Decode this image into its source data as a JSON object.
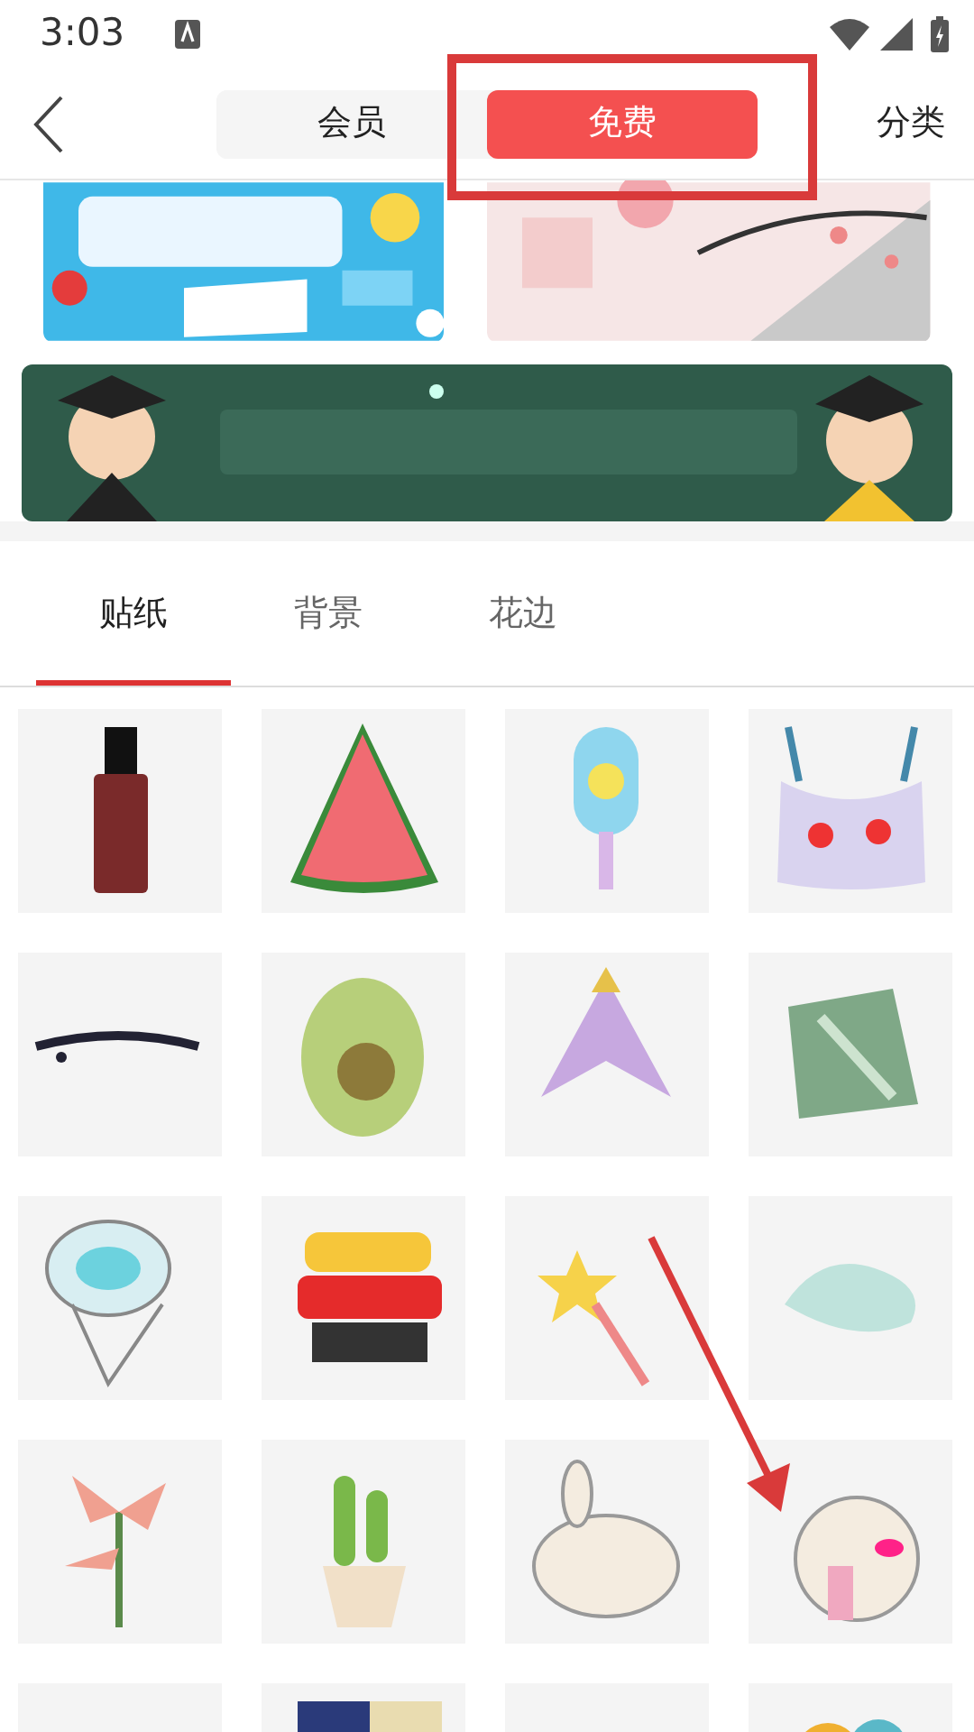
{
  "status_bar": {
    "time": "3:03"
  },
  "header": {
    "segments": [
      {
        "label": "会员",
        "selected": false
      },
      {
        "label": "免费",
        "selected": true
      }
    ],
    "right_link": "分类"
  },
  "tabs": [
    {
      "label": "贴纸",
      "selected": true
    },
    {
      "label": "背景",
      "selected": false
    },
    {
      "label": "花边",
      "selected": false
    }
  ],
  "annotations": [
    {
      "kind": "frame"
    },
    {
      "kind": "arrow"
    }
  ]
}
